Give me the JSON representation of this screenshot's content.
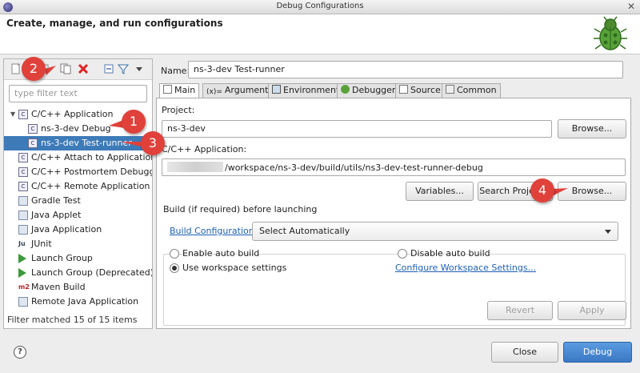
{
  "window": {
    "title": "Debug Configurations"
  },
  "header": {
    "heading": "Create, manage, and run configurations"
  },
  "left": {
    "filter_placeholder": "type filter text",
    "tree": [
      {
        "label": "C/C++ Application",
        "icon": "c-app-icon",
        "expanded": true
      },
      {
        "label": "ns-3-dev Debug",
        "icon": "c-config-icon"
      },
      {
        "label": "ns-3-dev Test-runner",
        "icon": "c-config-icon",
        "selected": true
      },
      {
        "label": "C/C++ Attach to Application",
        "icon": "c-app-icon"
      },
      {
        "label": "C/C++ Postmortem Debugger",
        "icon": "c-app-icon"
      },
      {
        "label": "C/C++ Remote Application",
        "icon": "c-app-icon"
      },
      {
        "label": "Gradle Test",
        "icon": "gradle-icon"
      },
      {
        "label": "Java Applet",
        "icon": "applet-icon"
      },
      {
        "label": "Java Application",
        "icon": "java-app-icon"
      },
      {
        "label": "JUnit",
        "icon": "junit-icon",
        "icon_text": "Ju"
      },
      {
        "label": "Launch Group",
        "icon": "launch-group-icon"
      },
      {
        "label": "Launch Group (Deprecated)",
        "icon": "launch-group-deprecated-icon"
      },
      {
        "label": "Maven Build",
        "icon": "maven-icon",
        "icon_text": "m2"
      },
      {
        "label": "Remote Java Application",
        "icon": "remote-java-icon"
      }
    ],
    "status": "Filter matched 15 of 15 items"
  },
  "right": {
    "name_label": "Name:",
    "name_value": "ns-3-dev Test-runner",
    "tabs": [
      "Main",
      "Arguments",
      "Environment",
      "Debugger",
      "Source",
      "Common"
    ],
    "project_label": "Project:",
    "project_value": "ns-3-dev",
    "browse_label": "Browse...",
    "app_label": "C/C++ Application:",
    "app_value": "/workspace/ns-3-dev/build/utils/ns3-dev-test-runner-debug",
    "variables_label": "Variables...",
    "search_project_label": "Search Project...",
    "build_group_title": "Build (if required) before launching",
    "build_config_link": "Build Configuration:",
    "build_config_value": "Select Automatically",
    "enable_auto_build": "Enable auto build",
    "disable_auto_build": "Disable auto build",
    "use_workspace": "Use workspace settings",
    "configure_workspace_link": "Configure Workspace Settings...",
    "revert_label": "Revert",
    "apply_label": "Apply"
  },
  "footer": {
    "help": "?",
    "close_label": "Close",
    "debug_label": "Debug"
  },
  "callouts": [
    "2",
    "1",
    "3",
    "4"
  ],
  "colors": {
    "selection": "#3d7ab8",
    "primary_button": "#3a78c4",
    "callout": "#e0413a",
    "link": "#1d5fb4"
  }
}
